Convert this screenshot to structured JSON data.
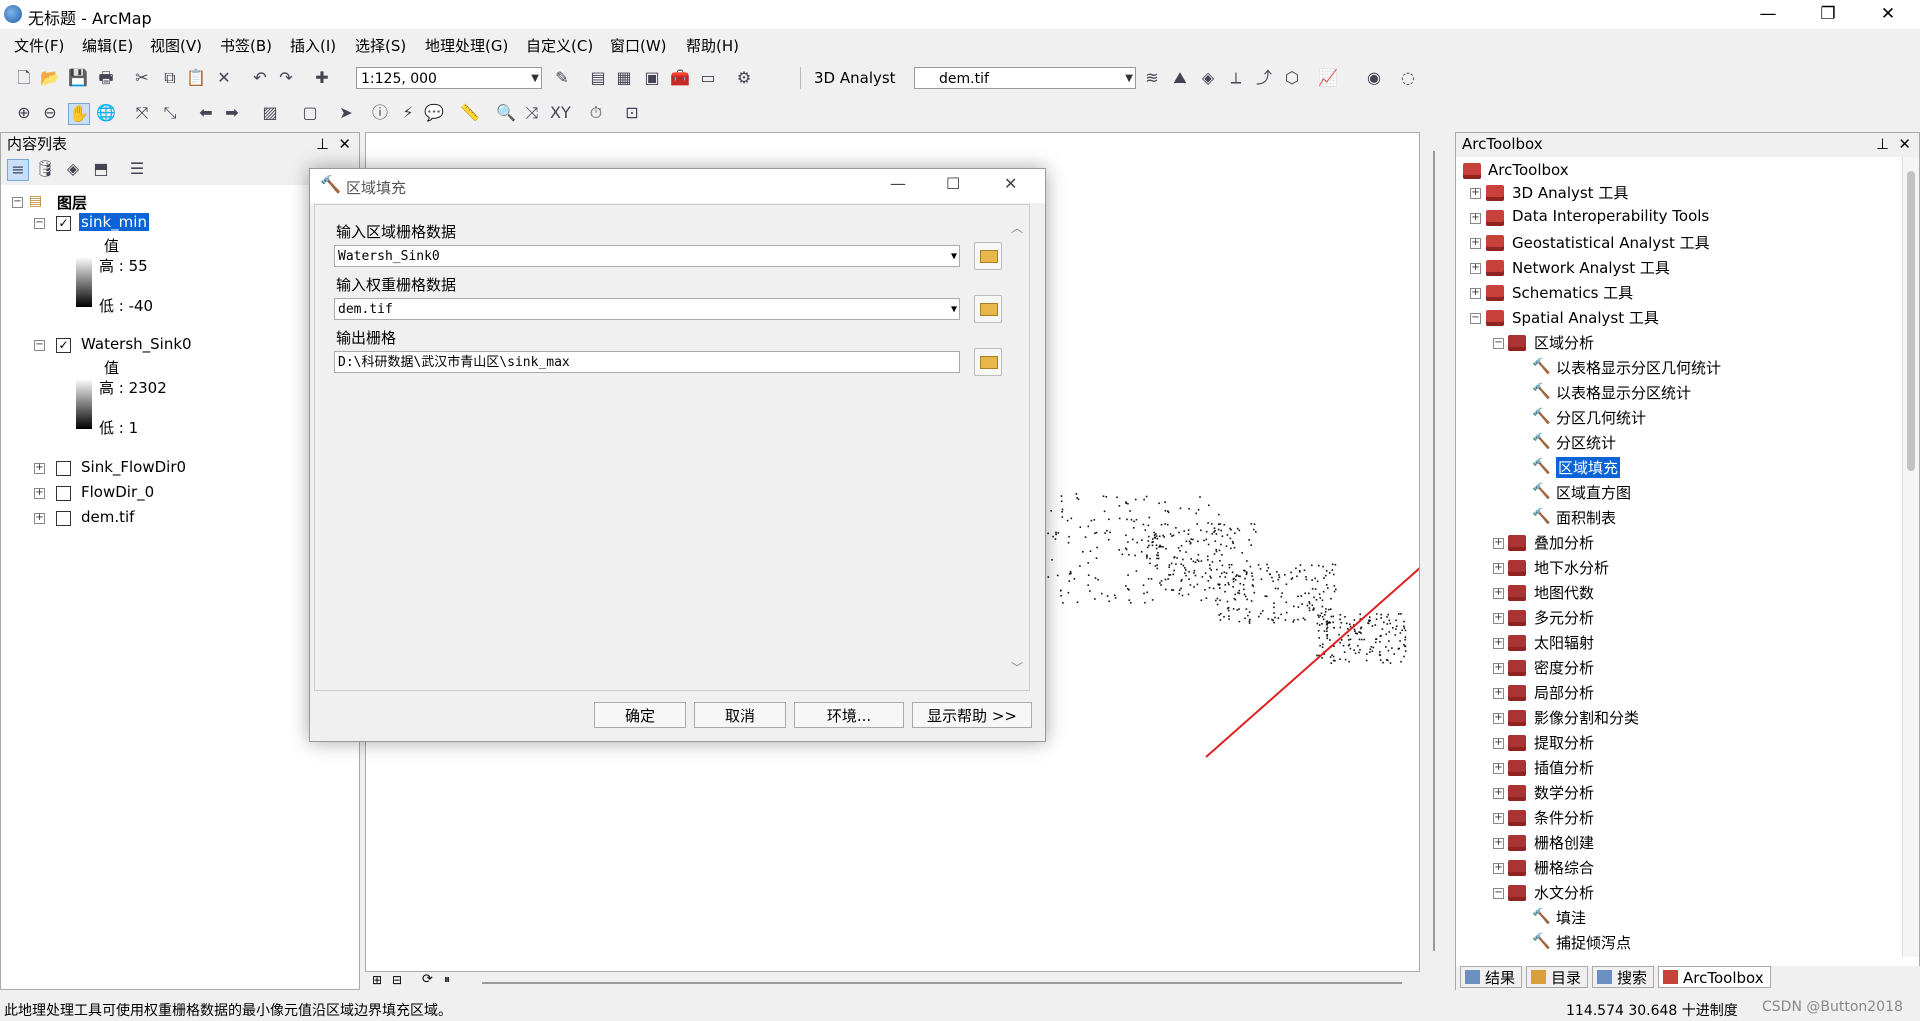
{
  "window": {
    "title": "无标题 - ArcMap",
    "minimize": "—",
    "maximize": "❐",
    "close": "✕"
  },
  "menu": [
    "文件(F)",
    "编辑(E)",
    "视图(V)",
    "书签(B)",
    "插入(I)",
    "选择(S)",
    "地理处理(G)",
    "自定义(C)",
    "窗口(W)",
    "帮助(H)"
  ],
  "toolbar": {
    "scale": "1:125, 000",
    "analyst_label": "3D Analyst",
    "layer_combo": "dem.tif"
  },
  "toc": {
    "title": "内容列表",
    "root": "图层",
    "layers": [
      {
        "name": "sink_min",
        "checked": true,
        "value_label": "值",
        "high": "高 : 55",
        "low": "低 : -40"
      },
      {
        "name": "Watersh_Sink0",
        "checked": true,
        "value_label": "值",
        "high": "高 : 2302",
        "low": "低 : 1"
      },
      {
        "name": "Sink_FlowDir0",
        "checked": false
      },
      {
        "name": "FlowDir_0",
        "checked": false
      },
      {
        "name": "dem.tif",
        "checked": false
      }
    ]
  },
  "dialog": {
    "title": "区域填充",
    "zone_label": "输入区域栅格数据",
    "zone_value": "Watersh_Sink0",
    "weight_label": "输入权重栅格数据",
    "weight_value": "dem.tif",
    "output_label": "输出栅格",
    "output_value": "D:\\科研数据\\武汉市青山区\\sink_max",
    "ok": "确定",
    "cancel": "取消",
    "env": "环境...",
    "help": "显示帮助 >>"
  },
  "arctoolbox": {
    "title": "ArcToolbox",
    "root": "ArcToolbox",
    "toolsets": [
      "3D Analyst 工具",
      "Data Interoperability Tools",
      "Geostatistical Analyst 工具",
      "Network Analyst 工具",
      "Schematics 工具",
      "Spatial Analyst 工具"
    ],
    "zonal": "区域分析",
    "zonal_tools": [
      "以表格显示分区几何统计",
      "以表格显示分区统计",
      "分区几何统计",
      "分区统计",
      "区域填充",
      "区域直方图",
      "面积制表"
    ],
    "spatial_sets": [
      "叠加分析",
      "地下水分析",
      "地图代数",
      "多元分析",
      "太阳辐射",
      "密度分析",
      "局部分析",
      "影像分割和分类",
      "提取分析",
      "插值分析",
      "数学分析",
      "条件分析",
      "栅格创建",
      "栅格综合",
      "水文分析"
    ],
    "hydro_tools": [
      "填洼",
      "捕捉倾泻点"
    ],
    "tabs": [
      "结果",
      "目录",
      "搜索",
      "ArcToolbox"
    ]
  },
  "status": {
    "message": "此地理处理工具可使用权重栅格数据的最小像元值沿区域边界填充区域。",
    "coords": "114.574  30.648 十进制度",
    "watermark": "CSDN @Button2018"
  }
}
